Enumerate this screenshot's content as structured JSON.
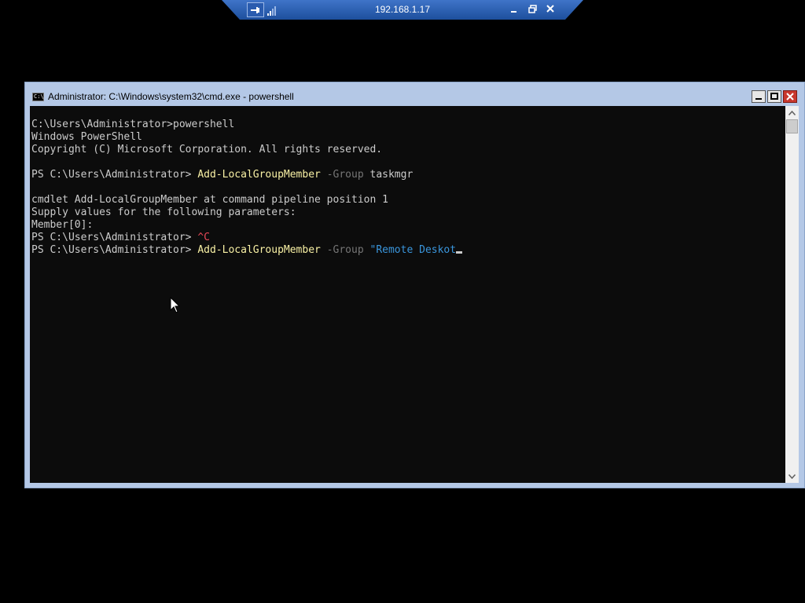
{
  "rdp_bar": {
    "host": "192.168.1.17",
    "pin_icon": "pin-icon",
    "signal_icon": "signal-strength-icon",
    "minimize_icon": "minimize-icon",
    "restore_icon": "restore-icon",
    "close_icon": "close-icon",
    "color": "#2a5caf"
  },
  "window": {
    "title": "Administrator: C:\\Windows\\system32\\cmd.exe - powershell",
    "icon": "cmd-icon",
    "icon_text": "C:\\",
    "controls": [
      "minimize",
      "maximize",
      "close"
    ],
    "frame_color": "#b4c8e6"
  },
  "console": {
    "background": "#0c0c0c",
    "lines": [
      {
        "parts": [
          {
            "text": "C:\\Users\\Administrator>powershell",
            "kind": "text"
          }
        ]
      },
      {
        "parts": [
          {
            "text": "Windows PowerShell",
            "kind": "text"
          }
        ]
      },
      {
        "parts": [
          {
            "text": "Copyright (C) Microsoft Corporation. All rights reserved.",
            "kind": "text"
          }
        ]
      },
      {
        "parts": []
      },
      {
        "parts": [
          {
            "text": "PS C:\\Users\\Administrator> ",
            "kind": "text"
          },
          {
            "text": "Add-LocalGroupMember",
            "kind": "cmd"
          },
          {
            "text": " ",
            "kind": "text"
          },
          {
            "text": "-Group",
            "kind": "param"
          },
          {
            "text": " taskmgr",
            "kind": "text"
          }
        ]
      },
      {
        "parts": []
      },
      {
        "parts": [
          {
            "text": "cmdlet Add-LocalGroupMember at command pipeline position 1",
            "kind": "text"
          }
        ]
      },
      {
        "parts": [
          {
            "text": "Supply values for the following parameters:",
            "kind": "text"
          }
        ]
      },
      {
        "parts": [
          {
            "text": "Member[0]:",
            "kind": "text"
          }
        ]
      },
      {
        "parts": [
          {
            "text": "PS C:\\Users\\Administrator> ",
            "kind": "text"
          },
          {
            "text": "^C",
            "kind": "ctrl"
          }
        ]
      },
      {
        "parts": [
          {
            "text": "PS C:\\Users\\Administrator> ",
            "kind": "text"
          },
          {
            "text": "Add-LocalGroupMember",
            "kind": "cmd"
          },
          {
            "text": " ",
            "kind": "text"
          },
          {
            "text": "-Group",
            "kind": "param"
          },
          {
            "text": " ",
            "kind": "text"
          },
          {
            "text": "\"Remote Deskot",
            "kind": "str"
          }
        ],
        "cursor": true
      }
    ],
    "colors": {
      "text": "#cccccc",
      "cmd": "#f9f1a5",
      "param": "#767676",
      "str": "#3a96dd",
      "ctrl": "#e74856"
    }
  },
  "scrollbar": {
    "up_icon": "scroll-up-arrow-icon",
    "down_icon": "scroll-down-arrow-icon"
  },
  "pointer": "mouse-pointer-icon"
}
